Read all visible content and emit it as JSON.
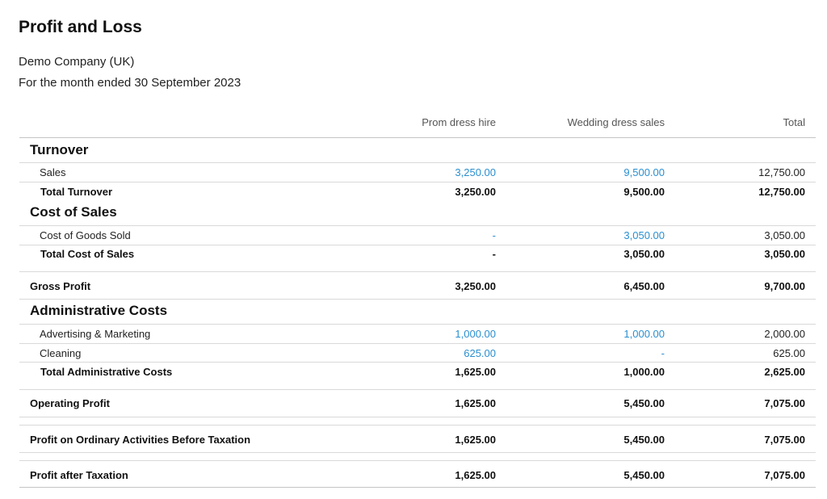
{
  "report": {
    "title": "Profit and Loss",
    "company": "Demo Company (UK)",
    "period": "For the month ended 30 September 2023"
  },
  "columns": [
    "Prom dress hire",
    "Wedding dress sales",
    "Total"
  ],
  "sections": {
    "turnover": {
      "heading": "Turnover",
      "sales": {
        "label": "Sales",
        "values": [
          "3,250.00",
          "9,500.00",
          "12,750.00"
        ]
      },
      "total": {
        "label": "Total Turnover",
        "values": [
          "3,250.00",
          "9,500.00",
          "12,750.00"
        ]
      }
    },
    "cost_of_sales": {
      "heading": "Cost of Sales",
      "cogs": {
        "label": "Cost of Goods Sold",
        "values": [
          "-",
          "3,050.00",
          "3,050.00"
        ]
      },
      "total": {
        "label": "Total Cost of Sales",
        "values": [
          "-",
          "3,050.00",
          "3,050.00"
        ]
      }
    },
    "gross_profit": {
      "label": "Gross Profit",
      "values": [
        "3,250.00",
        "6,450.00",
        "9,700.00"
      ]
    },
    "admin": {
      "heading": "Administrative Costs",
      "advertising": {
        "label": "Advertising & Marketing",
        "values": [
          "1,000.00",
          "1,000.00",
          "2,000.00"
        ]
      },
      "cleaning": {
        "label": "Cleaning",
        "values": [
          "625.00",
          "-",
          "625.00"
        ]
      },
      "total": {
        "label": "Total Administrative Costs",
        "values": [
          "1,625.00",
          "1,000.00",
          "2,625.00"
        ]
      }
    },
    "operating_profit": {
      "label": "Operating Profit",
      "values": [
        "1,625.00",
        "5,450.00",
        "7,075.00"
      ]
    },
    "profit_before_tax": {
      "label": "Profit on Ordinary Activities Before Taxation",
      "values": [
        "1,625.00",
        "5,450.00",
        "7,075.00"
      ]
    },
    "profit_after_tax": {
      "label": "Profit after Taxation",
      "values": [
        "1,625.00",
        "5,450.00",
        "7,075.00"
      ]
    }
  },
  "colors": {
    "link": "#2a8fd0",
    "rule": "#d9d9d9",
    "text": "#111111"
  }
}
